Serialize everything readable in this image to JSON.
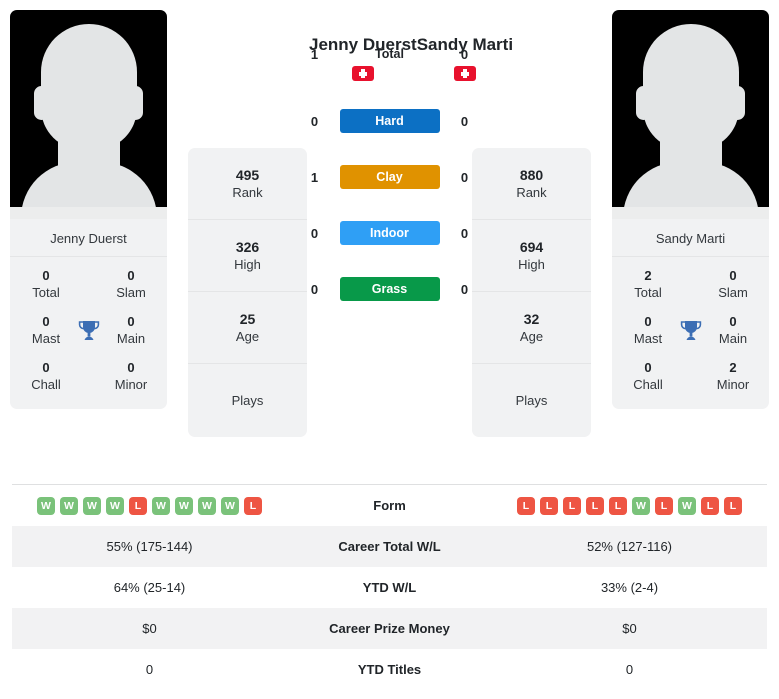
{
  "players": {
    "left": {
      "name": "Jenny Duerst",
      "flag": "swiss-flag",
      "card_name": "Jenny Duerst",
      "titles": {
        "total_val": "0",
        "total_lbl": "Total",
        "slam_val": "0",
        "slam_lbl": "Slam",
        "mast_val": "0",
        "mast_lbl": "Mast",
        "main_val": "0",
        "main_lbl": "Main",
        "chall_val": "0",
        "chall_lbl": "Chall",
        "minor_val": "0",
        "minor_lbl": "Minor"
      },
      "stats": [
        {
          "value": "495",
          "label": "Rank"
        },
        {
          "value": "326",
          "label": "High"
        },
        {
          "value": "25",
          "label": "Age"
        }
      ],
      "plays_label": "Plays",
      "form": [
        "W",
        "W",
        "W",
        "W",
        "L",
        "W",
        "W",
        "W",
        "W",
        "L"
      ],
      "career_total_wl": "55% (175-144)",
      "ytd_wl": "64% (25-14)",
      "career_prize_money": "$0",
      "ytd_titles": "0"
    },
    "right": {
      "name": "Sandy Marti",
      "flag": "swiss-flag",
      "card_name": "Sandy Marti",
      "titles": {
        "total_val": "2",
        "total_lbl": "Total",
        "slam_val": "0",
        "slam_lbl": "Slam",
        "mast_val": "0",
        "mast_lbl": "Mast",
        "main_val": "0",
        "main_lbl": "Main",
        "chall_val": "0",
        "chall_lbl": "Chall",
        "minor_val": "2",
        "minor_lbl": "Minor"
      },
      "stats": [
        {
          "value": "880",
          "label": "Rank"
        },
        {
          "value": "694",
          "label": "High"
        },
        {
          "value": "32",
          "label": "Age"
        }
      ],
      "plays_label": "Plays",
      "form": [
        "L",
        "L",
        "L",
        "L",
        "L",
        "W",
        "L",
        "W",
        "L",
        "L"
      ],
      "career_total_wl": "52% (127-116)",
      "ytd_wl": "33% (2-4)",
      "career_prize_money": "$0",
      "ytd_titles": "0"
    }
  },
  "h2h": {
    "total": {
      "label": "Total",
      "left": "1",
      "right": "0"
    },
    "surfaces": [
      {
        "label": "Hard",
        "left": "0",
        "right": "0",
        "color": "#0c70c4"
      },
      {
        "label": "Clay",
        "left": "1",
        "right": "0",
        "color": "#e09200"
      },
      {
        "label": "Indoor",
        "left": "0",
        "right": "0",
        "color": "#2f9ff5"
      },
      {
        "label": "Grass",
        "left": "0",
        "right": "0",
        "color": "#089949"
      }
    ]
  },
  "table": {
    "rows": [
      {
        "label": "Form",
        "type": "form"
      },
      {
        "label": "Career Total W/L",
        "type": "text",
        "left": "55% (175-144)",
        "right": "52% (127-116)"
      },
      {
        "label": "YTD W/L",
        "type": "text",
        "left": "64% (25-14)",
        "right": "33% (2-4)"
      },
      {
        "label": "Career Prize Money",
        "type": "text",
        "left": "$0",
        "right": "$0"
      },
      {
        "label": "YTD Titles",
        "type": "text",
        "left": "0",
        "right": "0"
      }
    ]
  },
  "colors": {
    "win": "#7ac27a",
    "loss": "#ee5543",
    "flag_red": "#e8112d",
    "trophy_blue": "#3c6eb4"
  }
}
